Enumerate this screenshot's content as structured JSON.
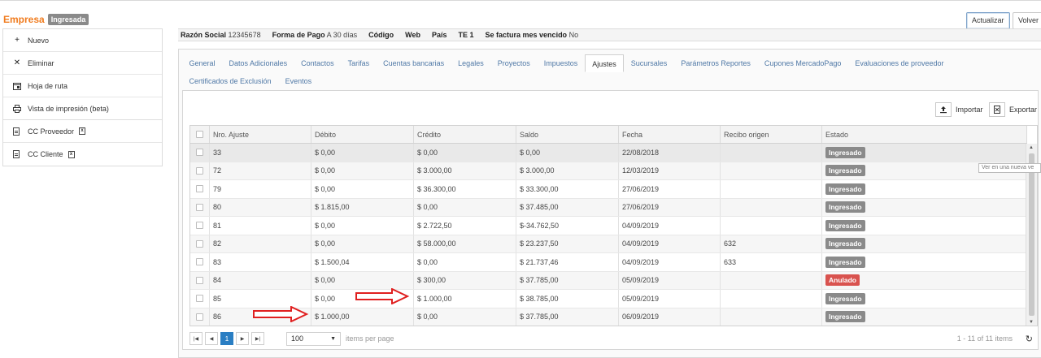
{
  "header": {
    "title": "Empresa",
    "status": "Ingresada",
    "refresh_label": "Actualizar",
    "back_label": "Volver"
  },
  "sidebar": {
    "group1": [
      {
        "label": "Nuevo",
        "icon": "plus-icon"
      },
      {
        "label": "Eliminar",
        "icon": "x-icon"
      },
      {
        "label": "Hoja de ruta",
        "icon": "calendar-icon"
      },
      {
        "label": "Vista de impresión (beta)",
        "icon": "printer-icon"
      }
    ],
    "group2": [
      {
        "label": "CC Proveedor",
        "icon": "file-icon"
      },
      {
        "label": "CC Cliente",
        "icon": "file-icon"
      }
    ]
  },
  "info": {
    "razon_label": "Razón Social",
    "razon_value": "12345678",
    "pago_label": "Forma de Pago",
    "pago_value": "A 30 días",
    "codigo_label": "Código",
    "web_label": "Web",
    "pais_label": "País",
    "te_label": "TE 1",
    "factura_label": "Se factura mes vencido",
    "factura_value": "No"
  },
  "tabs": [
    "General",
    "Datos Adicionales",
    "Contactos",
    "Tarifas",
    "Cuentas bancarias",
    "Legales",
    "Proyectos",
    "Impuestos",
    "Ajustes",
    "Sucursales",
    "Parámetros Reportes",
    "Cupones MercadoPago",
    "Evaluaciones de proveedor",
    "Certificados de Exclusión",
    "Eventos"
  ],
  "active_tab": "Ajustes",
  "toolbar": {
    "import_label": "Importar",
    "export_label": "Exportar"
  },
  "table": {
    "headers": [
      "Nro. Ajuste",
      "Débito",
      "Crédito",
      "Saldo",
      "Fecha",
      "Recibo origen",
      "Estado"
    ],
    "rows": [
      [
        "33",
        "$ 0,00",
        "$ 0,00",
        "$ 0,00",
        "22/08/2018",
        "",
        "Ingresado"
      ],
      [
        "72",
        "$ 0,00",
        "$ 3.000,00",
        "$ 3.000,00",
        "12/03/2019",
        "",
        "Ingresado"
      ],
      [
        "79",
        "$ 0,00",
        "$ 36.300,00",
        "$ 33.300,00",
        "27/06/2019",
        "",
        "Ingresado"
      ],
      [
        "80",
        "$ 1.815,00",
        "$ 0,00",
        "$ 37.485,00",
        "27/06/2019",
        "",
        "Ingresado"
      ],
      [
        "81",
        "$ 0,00",
        "$ 2.722,50",
        "$-34.762,50",
        "04/09/2019",
        "",
        "Ingresado"
      ],
      [
        "82",
        "$ 0,00",
        "$ 58.000,00",
        "$ 23.237,50",
        "04/09/2019",
        "632",
        "Ingresado"
      ],
      [
        "83",
        "$ 1.500,04",
        "$ 0,00",
        "$ 21.737,46",
        "04/09/2019",
        "633",
        "Ingresado"
      ],
      [
        "84",
        "$ 0,00",
        "$ 300,00",
        "$ 37.785,00",
        "05/09/2019",
        "",
        "Anulado"
      ],
      [
        "85",
        "$ 0,00",
        "$ 1.000,00",
        "$ 38.785,00",
        "05/09/2019",
        "",
        "Ingresado"
      ],
      [
        "86",
        "$ 1.000,00",
        "$ 0,00",
        "$ 37.785,00",
        "06/09/2019",
        "",
        "Ingresado"
      ]
    ]
  },
  "tooltip": "Ver en una nueva ve",
  "pager": {
    "current_page": "1",
    "page_size": "100",
    "items_label": "items per page",
    "info": "1 - 11 of 11 items"
  },
  "colors": {
    "brand": "#f07c1f",
    "link": "#4f78a6",
    "status_gray": "#8a8a8a",
    "status_red": "#d9534f",
    "arrow": "#e02020",
    "pager_active": "#2a7ec3"
  }
}
